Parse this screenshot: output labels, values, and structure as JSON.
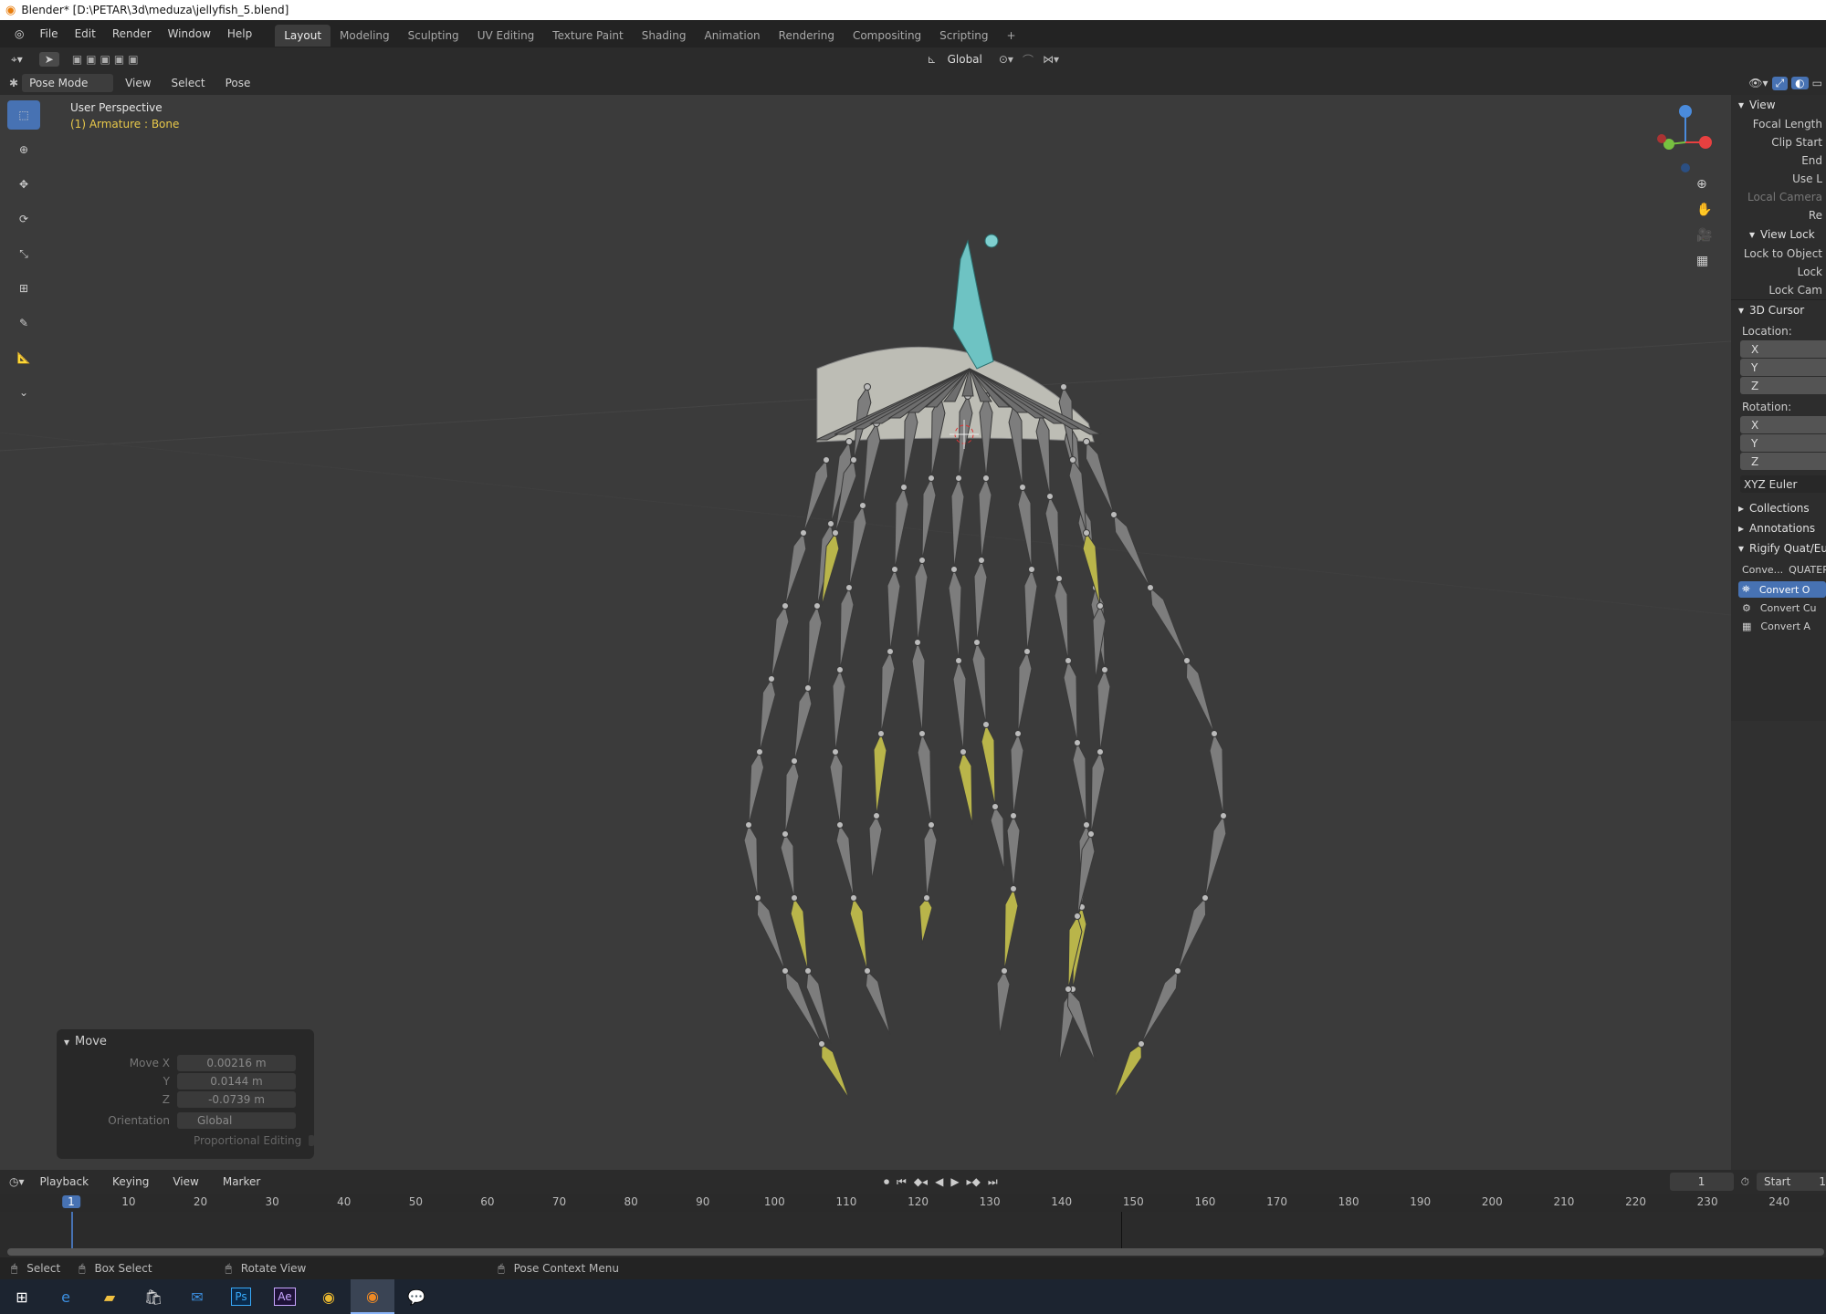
{
  "title": "Blender* [D:\\PETAR\\3d\\meduza\\jellyfish_5.blend]",
  "menu": [
    "File",
    "Edit",
    "Render",
    "Window",
    "Help"
  ],
  "workspaces": [
    "Layout",
    "Modeling",
    "Sculpting",
    "UV Editing",
    "Texture Paint",
    "Shading",
    "Animation",
    "Rendering",
    "Compositing",
    "Scripting"
  ],
  "header": {
    "orientation": "Global"
  },
  "viewport_header": {
    "mode": "Pose Mode",
    "menus": [
      "View",
      "Select",
      "Pose"
    ]
  },
  "overlay": {
    "perspective": "User Perspective",
    "object": "(1) Armature : Bone"
  },
  "npanel": {
    "view_title": "View",
    "view_rows": [
      "Focal Length",
      "Clip Start",
      "End",
      "Use L",
      "Local Camera",
      "Re"
    ],
    "view_lock_title": "View Lock",
    "view_lock_rows": [
      "Lock to Object",
      "Lock",
      "Lock Cam"
    ],
    "cursor_title": "3D Cursor",
    "location_label": "Location:",
    "rotation_label": "Rotation:",
    "axes": [
      "X",
      "Y",
      "Z"
    ],
    "rotation_mode": "XYZ Euler",
    "collections": "Collections",
    "annotations": "Annotations",
    "rigify_title": "Rigify Quat/Eul",
    "conv_label": "Conve...",
    "conv_value": "QUATER",
    "convert_buttons": [
      "Convert O",
      "Convert Cu",
      "Convert A"
    ]
  },
  "move_panel": {
    "title": "Move",
    "move_x_label": "Move X",
    "move_x": "0.00216 m",
    "y_label": "Y",
    "y": "0.0144 m",
    "z_label": "Z",
    "z": "-0.0739 m",
    "orientation_label": "Orientation",
    "orientation": "Global",
    "proportional": "Proportional Editing"
  },
  "timeline": {
    "menus": [
      "Playback",
      "Keying",
      "View",
      "Marker"
    ],
    "current_frame": "1",
    "start_label": "Start",
    "start_value": "1",
    "ticks": [
      "1",
      "10",
      "20",
      "30",
      "40",
      "50",
      "60",
      "70",
      "80",
      "90",
      "100",
      "110",
      "120",
      "130",
      "140",
      "150",
      "160",
      "170",
      "180",
      "190",
      "200",
      "210",
      "220",
      "230",
      "240"
    ]
  },
  "status": {
    "select": "Select",
    "box_select": "Box Select",
    "rotate": "Rotate View",
    "context": "Pose Context Menu"
  },
  "taskbar": [
    "windows-icon",
    "edge-icon",
    "folder-icon",
    "store-icon",
    "mail-icon",
    "photoshop-icon",
    "after-effects-icon",
    "chrome-icon",
    "blender-icon",
    "chat-icon"
  ]
}
